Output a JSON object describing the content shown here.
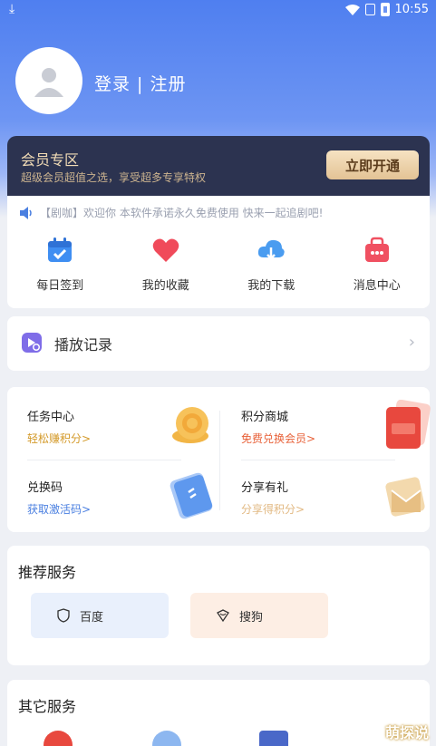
{
  "statusbar": {
    "time": "10:55"
  },
  "profile": {
    "login_text": "登录 | 注册"
  },
  "vip": {
    "title": "会员专区",
    "subtitle": "超级会员超值之选，享受超多专享特权",
    "button": "立即开通"
  },
  "notice": {
    "text": "【剧咖】欢迎你 本软件承诺永久免费使用 快来一起追剧吧!"
  },
  "quick": {
    "items": [
      {
        "label": "每日签到",
        "icon": "calendar-check-icon",
        "color": "#3f8ef2"
      },
      {
        "label": "我的收藏",
        "icon": "heart-icon",
        "color": "#f04a5a"
      },
      {
        "label": "我的下载",
        "icon": "cloud-download-icon",
        "color": "#4a9cf0"
      },
      {
        "label": "消息中心",
        "icon": "message-box-icon",
        "color": "#f05061"
      }
    ]
  },
  "history": {
    "label": "播放记录"
  },
  "tasks": {
    "items": [
      {
        "name": "任务中心",
        "sub": "轻松赚积分>",
        "sub_color": "#d49a2a"
      },
      {
        "name": "积分商城",
        "sub": "免费兑换会员>",
        "sub_color": "#e8623a"
      },
      {
        "name": "兑换码",
        "sub": "获取激活码>",
        "sub_color": "#4a7fe0"
      },
      {
        "name": "分享有礼",
        "sub": "分享得积分>",
        "sub_color": "#e2b983"
      }
    ]
  },
  "recommend": {
    "title": "推荐服务",
    "items": [
      {
        "label": "百度",
        "icon": "shield-icon"
      },
      {
        "label": "搜狗",
        "icon": "sogou-icon"
      }
    ]
  },
  "other": {
    "title": "其它服务"
  },
  "watermark": "萌探说"
}
